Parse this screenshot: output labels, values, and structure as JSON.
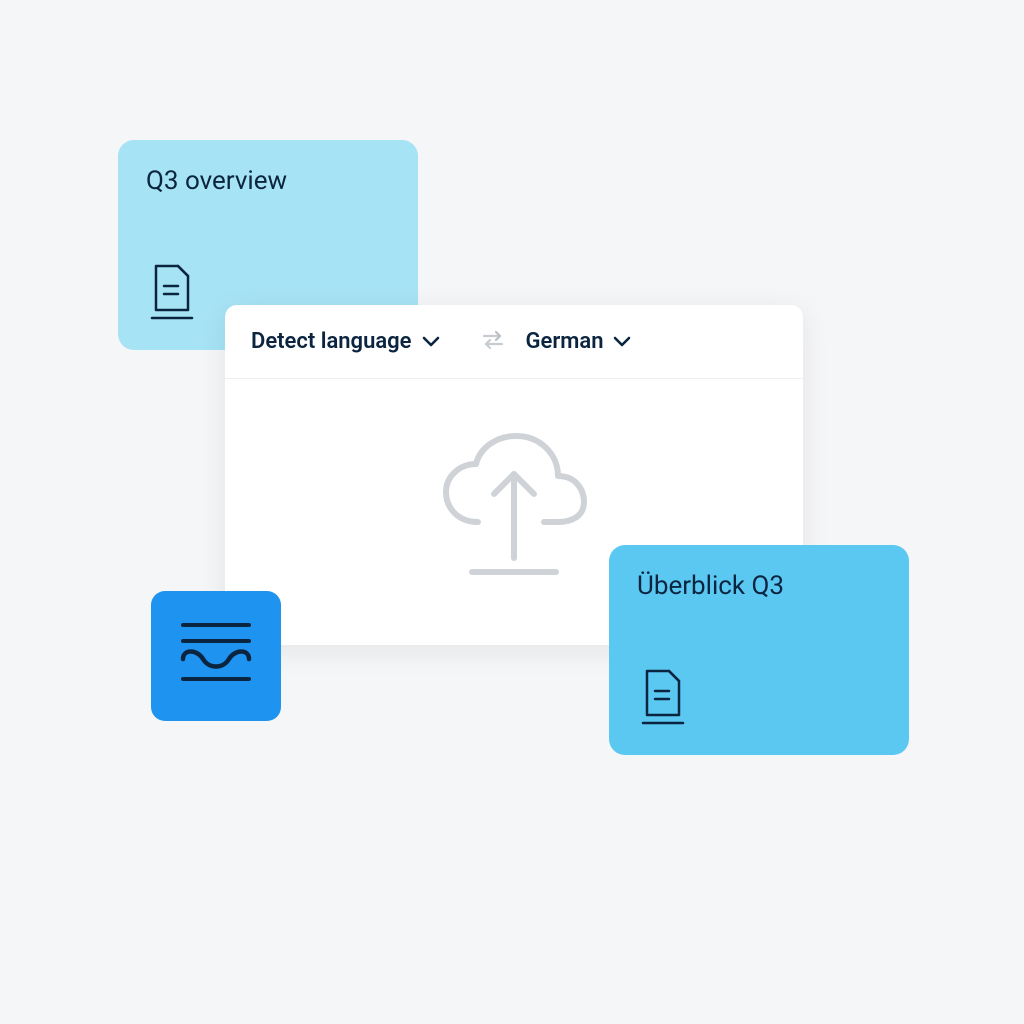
{
  "source_card": {
    "title": "Q3 overview"
  },
  "target_card": {
    "title": "Überblick Q3"
  },
  "translate_panel": {
    "source_lang_label": "Detect language",
    "target_lang_label": "German"
  },
  "colors": {
    "text_dark": "#0b2540",
    "card_light": "#a6e3f5",
    "card_mid": "#5bc8f2",
    "accent_blue": "#1f93f0",
    "panel_bg": "#ffffff",
    "page_bg": "#f5f6f7"
  }
}
